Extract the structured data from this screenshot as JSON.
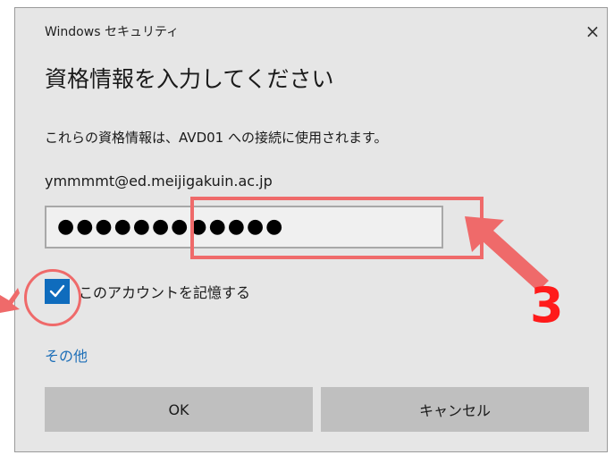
{
  "dialog": {
    "window_title": "Windows セキュリティ",
    "close_icon": "×",
    "heading": "資格情報を入力してください",
    "message": "これらの資格情報は、AVD01 への接続に使用されます。",
    "username": "ymmmmt@ed.meijigakuin.ac.jp",
    "password_mask": "●●●●●●●●●●●●",
    "remember_label": "このアカウントを記憶する",
    "remember_checked": true,
    "more_link": "その他",
    "ok_label": "OK",
    "cancel_label": "キャンセル"
  },
  "annotation": {
    "step_number": "3",
    "color": "#ef6a6a",
    "number_color": "#ff1a1a"
  },
  "colors": {
    "dialog_bg": "#e6e6e6",
    "accent": "#0f6cbd",
    "link": "#1d6fb8",
    "button_bg": "#bfbfbf"
  }
}
